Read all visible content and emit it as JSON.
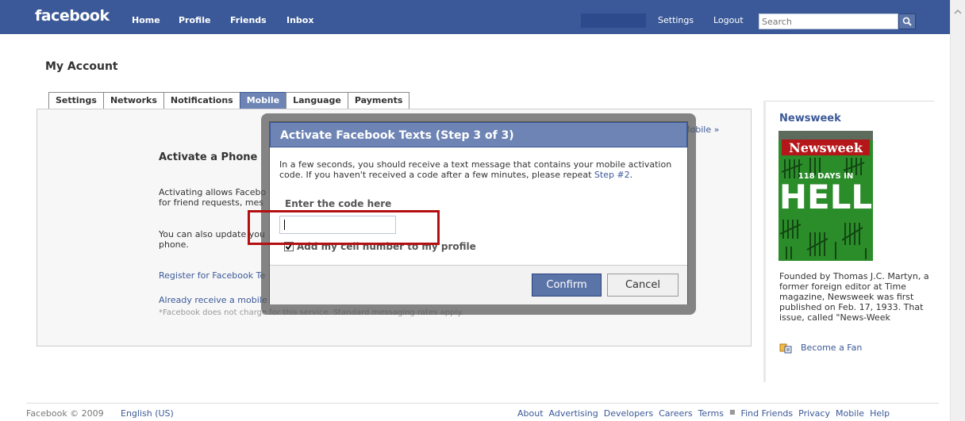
{
  "colors": {
    "brand_blue": "#3b5998",
    "header_blue": "#6d84b4",
    "highlight_red": "#b40f10",
    "link": "#3b5998"
  },
  "topnav": {
    "logo": "facebook",
    "home": "Home",
    "profile": "Profile",
    "friends": "Friends",
    "inbox": "Inbox",
    "settings": "Settings",
    "logout": "Logout",
    "search_placeholder": "Search",
    "search_icon": "magnifier-icon"
  },
  "page_title": "My Account",
  "tabs": {
    "settings": "Settings",
    "networks": "Networks",
    "notifications": "Notifications",
    "mobile": "Mobile",
    "language": "Language",
    "payments": "Payments",
    "active": "Mobile"
  },
  "panel": {
    "heading": "Activate a Phone",
    "para1_line1": "Activating allows Facebo",
    "para1_line2": "for friend requests, mes",
    "para2_line1": "You can also update you",
    "para2_line2": "phone.",
    "register_link": "Register for Facebook Te",
    "already_link": "Already receive a mobile",
    "note": "*Facebook does not charge for this service. Standard messaging rates apply.",
    "mobile_link": "Mobile »"
  },
  "dialog": {
    "title": "Activate Facebook Texts (Step 3 of 3)",
    "body": "In a few seconds, you should receive a text message that contains your mobile activation code. If you haven't received a code after a few minutes, please repeat",
    "step_link": "Step #2",
    "code_label": "Enter the code here",
    "code_value": "",
    "add_cell_label": "Add my cell number to my profile",
    "add_cell_checked": true,
    "confirm": "Confirm",
    "cancel": "Cancel"
  },
  "sidebar": {
    "title": "Newsweek",
    "cover_logo": "Newsweek",
    "cover_days": "118 DAYS IN",
    "cover_hell": "HELL",
    "description": "Founded by Thomas J.C. Martyn, a former foreign editor at Time magazine, Newsweek was first published on Feb. 17, 1933. That issue, called \"News-Week",
    "fan_link": "Become a Fan"
  },
  "footer": {
    "copyright": "Facebook © 2009",
    "language": "English (US)",
    "links": [
      "About",
      "Advertising",
      "Developers",
      "Careers",
      "Terms",
      "Find Friends",
      "Privacy",
      "Mobile",
      "Help"
    ]
  }
}
